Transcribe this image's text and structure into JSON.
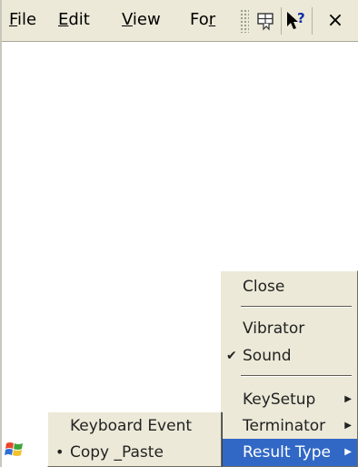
{
  "menubar": {
    "items": [
      {
        "label": "File",
        "accel": "F",
        "rest": "ile"
      },
      {
        "label": "Edit",
        "accel": "E",
        "rest": "dit"
      },
      {
        "label": "View",
        "accel": "V",
        "rest": "iew"
      },
      {
        "label": "For",
        "accel": "",
        "rest": "Fo",
        "accel_tail": "r"
      }
    ],
    "close_label": "×"
  },
  "result_menu": {
    "items": [
      "Close",
      "Vibrator",
      "Sound",
      "KeySetup",
      "Terminator",
      "Result Type"
    ],
    "checked": "Sound",
    "selected": "Result Type"
  },
  "result_type_submenu": {
    "items": [
      "Keyboard Event",
      "Copy _Paste"
    ],
    "bullet_item": "Copy _Paste"
  },
  "colors": {
    "menu_bg": "#ece9d8",
    "highlight": "#3168c6"
  }
}
